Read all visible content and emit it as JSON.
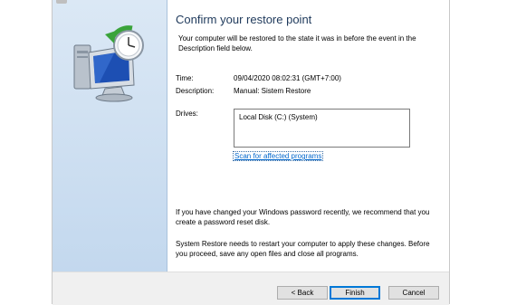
{
  "wizard": {
    "heading": "Confirm your restore point",
    "intro": "Your computer will be restored to the state it was in before the event in the Description field below.",
    "time_label": "Time:",
    "time_value": "09/04/2020 08:02:31 (GMT+7:00)",
    "description_label": "Description:",
    "description_value": "Manual: Sistem Restore",
    "drives_label": "Drives:",
    "drives": [
      "Local Disk (C:) (System)"
    ],
    "scan_link": "Scan for affected programs",
    "password_note": "If you have changed your Windows password recently, we recommend that you create a password reset disk.",
    "restart_note": "System Restore needs to restart your computer to apply these changes. Before you proceed, save any open files and close all programs."
  },
  "buttons": {
    "back": "< Back",
    "finish": "Finish",
    "cancel": "Cancel"
  },
  "icons": {
    "hero": "system-restore-icon",
    "title": "system-restore-small-icon"
  },
  "colors": {
    "heading": "#1e395b",
    "link": "#0066cc",
    "panel": "#c3d8ee",
    "default_button_border": "#0078d7"
  }
}
